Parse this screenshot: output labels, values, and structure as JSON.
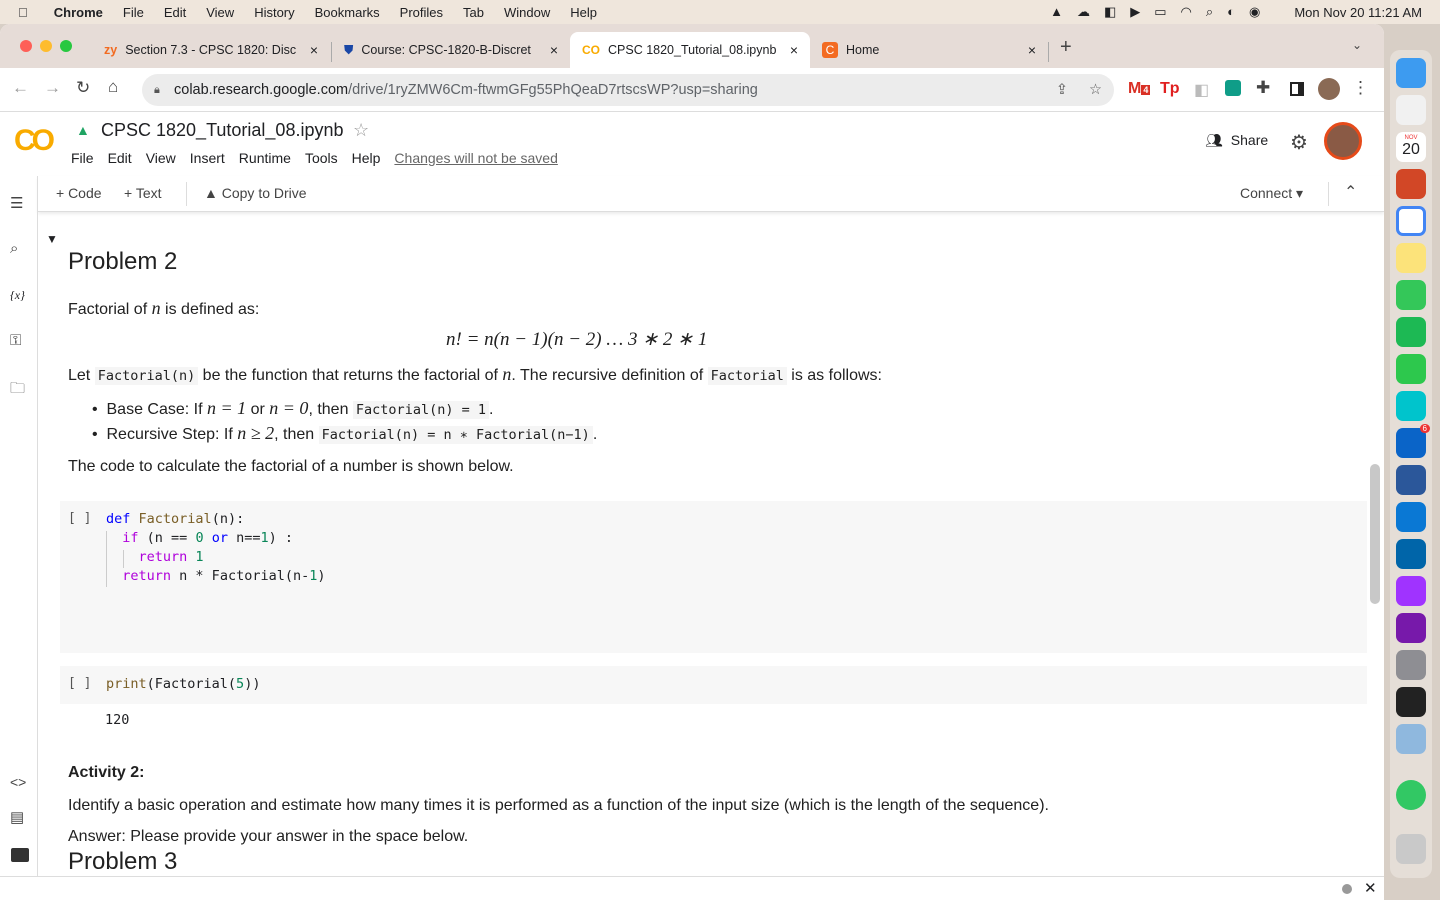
{
  "menubar": {
    "app": "Chrome",
    "items": [
      "File",
      "Edit",
      "View",
      "History",
      "Bookmarks",
      "Profiles",
      "Tab",
      "Window",
      "Help"
    ],
    "clock": "Mon Nov 20  11:21 AM"
  },
  "tabs": [
    {
      "label": "Section 7.3 - CPSC 1820: Disc",
      "icon": "zy"
    },
    {
      "label": "Course: CPSC-1820-B-Discret",
      "icon": "shield"
    },
    {
      "label": "CPSC 1820_Tutorial_08.ipynb",
      "icon": "CO"
    },
    {
      "label": "Home",
      "icon": "C"
    }
  ],
  "url": {
    "host": "colab.research.google.com",
    "path": "/drive/1ryZMW6Cm-ftwmGFg55PhQeaD7rtscsWP?usp=sharing"
  },
  "extensions": {
    "gmail_badge": "4"
  },
  "colab": {
    "logo": "CO",
    "title": "CPSC 1820_Tutorial_08.ipynb",
    "menu": [
      "File",
      "Edit",
      "View",
      "Insert",
      "Runtime",
      "Tools",
      "Help"
    ],
    "unsaved": "Changes will not be saved",
    "share": "Share",
    "add_code": "+ Code",
    "add_text": "+ Text",
    "copy_drive": "Copy to Drive",
    "connect": "Connect"
  },
  "notebook": {
    "heading": "Problem 2",
    "intro_a": "Factorial of ",
    "intro_n": "n",
    "intro_b": " is defined as:",
    "formula": "n! = n(n − 1)(n − 2) … 3 ∗ 2 ∗ 1",
    "let_a": "Let ",
    "let_code": "Factorial(n)",
    "let_b": " be the function that returns the factorial of ",
    "let_n": "n",
    "let_c": ". The recursive definition of ",
    "let_code2": "Factorial",
    "let_d": " is as follows:",
    "base_a": "Base Case: If ",
    "base_m1": "n = 1",
    "base_b": " or ",
    "base_m2": "n = 0",
    "base_c": ", then ",
    "base_code": "Factorial(n) = 1",
    "base_d": ".",
    "rec_a": "Recursive Step: If ",
    "rec_m": "n ≥ 2",
    "rec_b": ", then ",
    "rec_code": "Factorial(n) = n ∗ Factorial(n−1)",
    "rec_c": ".",
    "code_intro": "The code to calculate the factorial of a number is shown below.",
    "cell_prompt": "[ ]",
    "cell1": {
      "l1_kw": "def",
      "l1_fn": "Factorial",
      "l1_rest": "(n):",
      "l2_kw": "if",
      "l2_a": " (n == ",
      "l2_n": "0",
      "l2_or": " or",
      "l2_b": " n==",
      "l2_n2": "1",
      "l2_c": ") :",
      "l3_kw": "return",
      "l3_n": " 1",
      "l4_kw": "return",
      "l4_a": " n * Factorial(n-",
      "l4_n": "1",
      "l4_b": ")"
    },
    "cell2": {
      "fn": "print",
      "a": "(Factorial(",
      "n": "5",
      "b": "))",
      "output": "120"
    },
    "activity_title": "Activity 2:",
    "activity_text": "Identify a basic operation and estimate how many times it is performed as a function of the input size (which is the length of the sequence).",
    "answer": "Answer: Please provide your answer in the space below.",
    "next_heading": "Problem 3"
  },
  "dock": {
    "calendar_month": "NOV",
    "calendar_day": "20",
    "outlook_badge": "6"
  }
}
